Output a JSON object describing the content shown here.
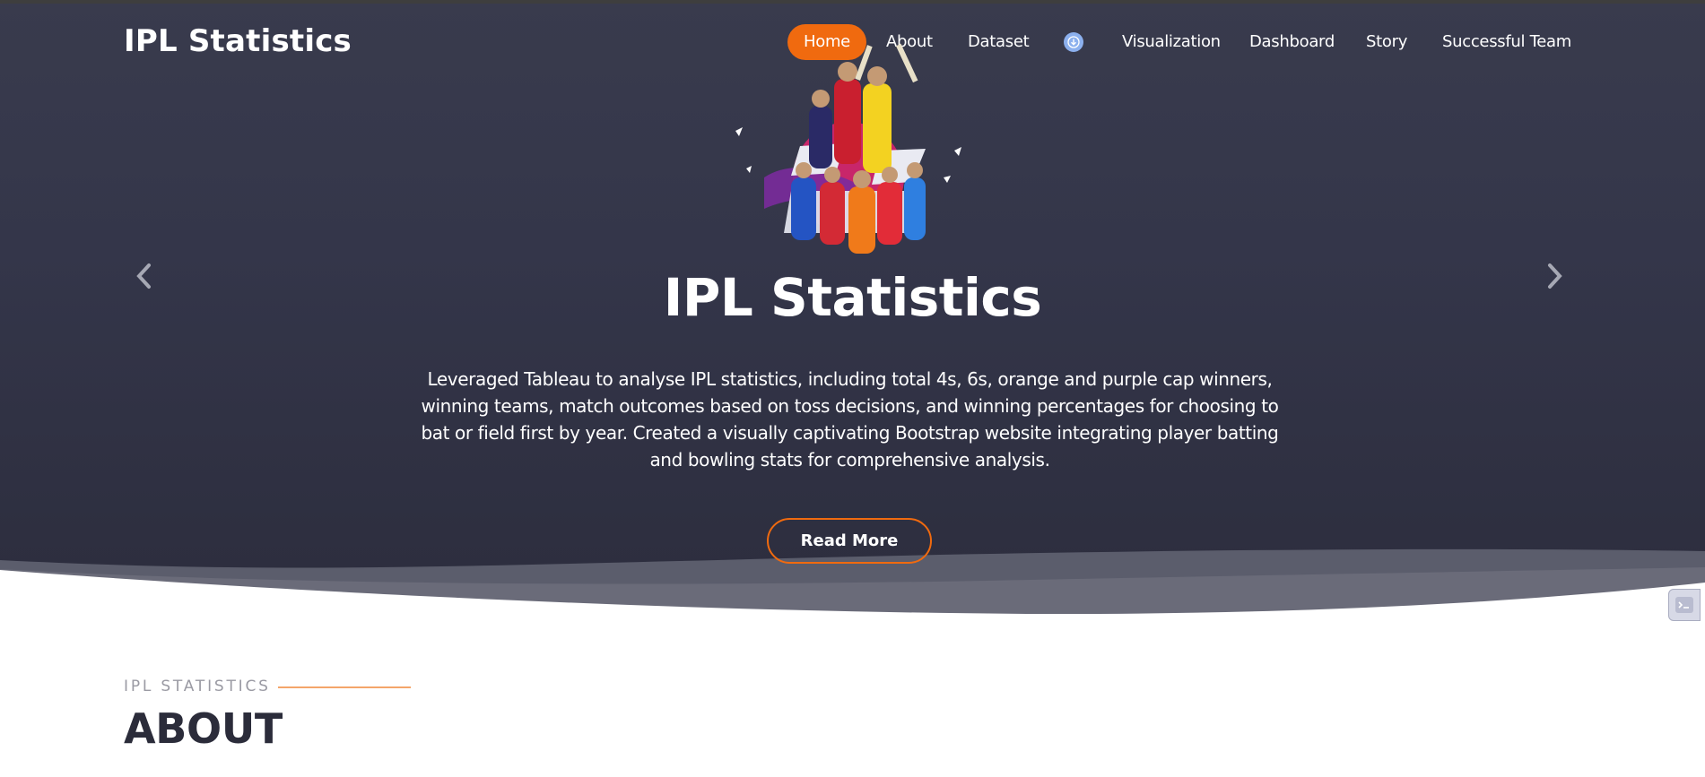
{
  "brand": {
    "title": "IPL Statistics"
  },
  "nav": {
    "items": [
      {
        "label": "Home",
        "active": true
      },
      {
        "label": "About"
      },
      {
        "label": "Dataset"
      },
      {
        "label": "Visualization"
      },
      {
        "label": "Dashboard"
      },
      {
        "label": "Story"
      },
      {
        "label": "Successful Team"
      }
    ],
    "download_icon": "download-circle-icon"
  },
  "hero": {
    "image": "ipl-players-collage",
    "title": "IPL Statistics",
    "description": "Leveraged Tableau to analyse IPL statistics, including total 4s, 6s, orange and purple cap winners, winning teams, match outcomes based on toss decisions, and winning percentages for choosing to bat or field first by year. Created a visually captivating Bootstrap website integrating player batting and bowling stats for comprehensive analysis.",
    "read_more_label": "Read More",
    "prev_icon": "chevron-left-icon",
    "next_icon": "chevron-right-icon"
  },
  "about": {
    "subtitle": "IPL STATISTICS",
    "title": "ABOUT"
  },
  "colors": {
    "accent": "#f06a0f",
    "hero_bg": "#34364a",
    "heading_dark": "#2b2c3a"
  }
}
